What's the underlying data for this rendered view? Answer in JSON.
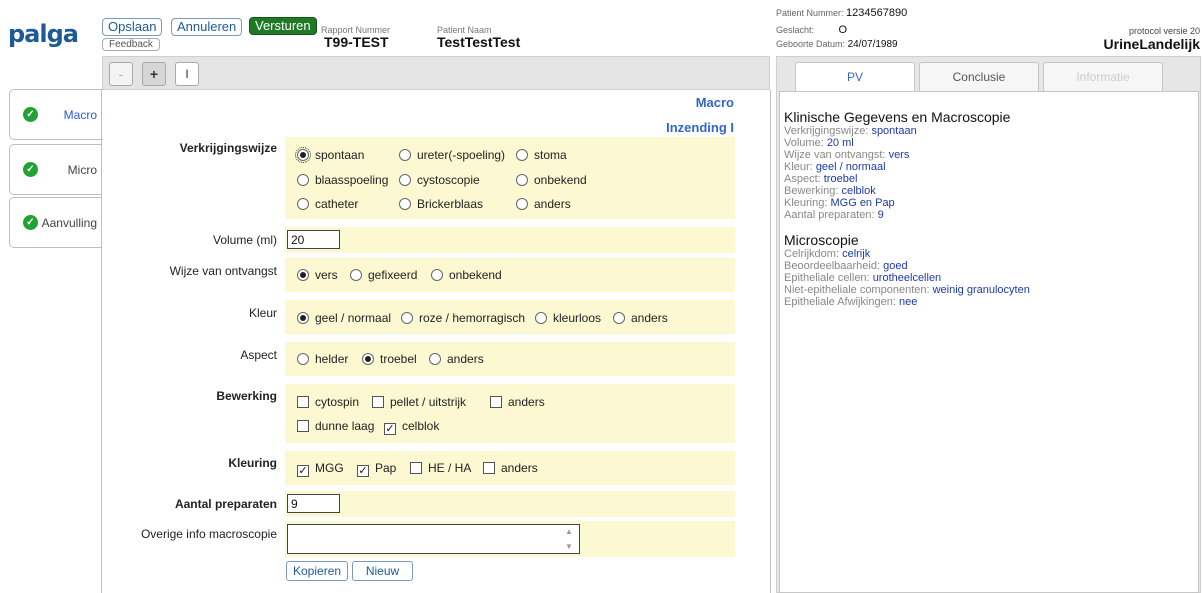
{
  "header": {
    "logo": "palga",
    "save_label": "Opslaan",
    "cancel_label": "Annuleren",
    "send_label": "Versturen",
    "feedback_label": "Feedback",
    "report_number_label": "Rapport Nummer",
    "report_number": "T99-TEST",
    "patient_name_label": "Patient Naam",
    "patient_name": "TestTestTest",
    "patient_number_label": "Patient Nummer:",
    "patient_number": "1234567890",
    "gender_label": "Geslacht:",
    "gender": "O",
    "birth_label": "Geboorte Datum:",
    "birth_date": "24/07/1989",
    "protocol_version": "protocol versie 20",
    "protocol_name": "UrineLandelijk"
  },
  "toolbar": {
    "minus": "-",
    "plus": "+",
    "roman": "I"
  },
  "sidebar": {
    "items": [
      {
        "label": "Macro"
      },
      {
        "label": "Micro"
      },
      {
        "label": "Aanvulling"
      }
    ]
  },
  "form": {
    "section_title": "Macro",
    "subsection_title": "Inzending I",
    "verkrijgingswijze": {
      "label": "Verkrijgingswijze",
      "options": [
        "spontaan",
        "ureter(-spoeling)",
        "stoma",
        "blaasspoeling",
        "cystoscopie",
        "onbekend",
        "catheter",
        "Brickerblaas",
        "anders"
      ],
      "selected": "spontaan"
    },
    "volume": {
      "label": "Volume (ml)",
      "value": "20"
    },
    "ontvangst": {
      "label": "Wijze van ontvangst",
      "options": [
        "vers",
        "gefixeerd",
        "onbekend"
      ],
      "selected": "vers"
    },
    "kleur": {
      "label": "Kleur",
      "options": [
        "geel / normaal",
        "roze / hemorragisch",
        "kleurloos",
        "anders"
      ],
      "selected": "geel / normaal"
    },
    "aspect": {
      "label": "Aspect",
      "options": [
        "helder",
        "troebel",
        "anders"
      ],
      "selected": "troebel"
    },
    "bewerking": {
      "label": "Bewerking",
      "options": [
        "cytospin",
        "pellet / uitstrijk",
        "anders",
        "dunne laag",
        "celblok"
      ],
      "checked": [
        "celblok"
      ]
    },
    "kleuring": {
      "label": "Kleuring",
      "options": [
        "MGG",
        "Pap",
        "HE / HA",
        "anders"
      ],
      "checked": [
        "MGG",
        "Pap"
      ]
    },
    "aantal": {
      "label": "Aantal preparaten",
      "value": "9"
    },
    "overige": {
      "label": "Overige info macroscopie",
      "value": ""
    },
    "copy_label": "Kopieren",
    "new_label": "Nieuw"
  },
  "report": {
    "tabs": [
      "PV",
      "Conclusie",
      "Informatie"
    ],
    "heading1": "Klinische Gegevens en Macroscopie",
    "lines1": [
      {
        "k": "Verkrijgingswijze:",
        "v": "spontaan"
      },
      {
        "k": "Volume:",
        "v": "20 ml"
      },
      {
        "k": "Wijze van ontvangst:",
        "v": "vers"
      },
      {
        "k": "Kleur:",
        "v": "geel / normaal"
      },
      {
        "k": "Aspect:",
        "v": "troebel"
      },
      {
        "k": "Bewerking:",
        "v": "celblok"
      },
      {
        "k": "Kleuring:",
        "v": "MGG en Pap"
      },
      {
        "k": "Aantal preparaten:",
        "v": "9"
      }
    ],
    "heading2": "Microscopie",
    "lines2": [
      {
        "k": "Celrijkdom:",
        "v": "celrijk"
      },
      {
        "k": "Beoordeelbaarheid:",
        "v": "goed"
      },
      {
        "k": "Epitheliale cellen:",
        "v": "urotheelcellen"
      },
      {
        "k": "Niet-epitheliale componenten:",
        "v": "weinig granulocyten"
      },
      {
        "k": "Epitheliale Afwijkingen:",
        "v": "nee"
      }
    ]
  },
  "colors": {
    "accent_blue": "#3366cc",
    "send_green": "#1e7a23",
    "field_bg": "#fbf8d2",
    "check_green": "#21a334"
  }
}
